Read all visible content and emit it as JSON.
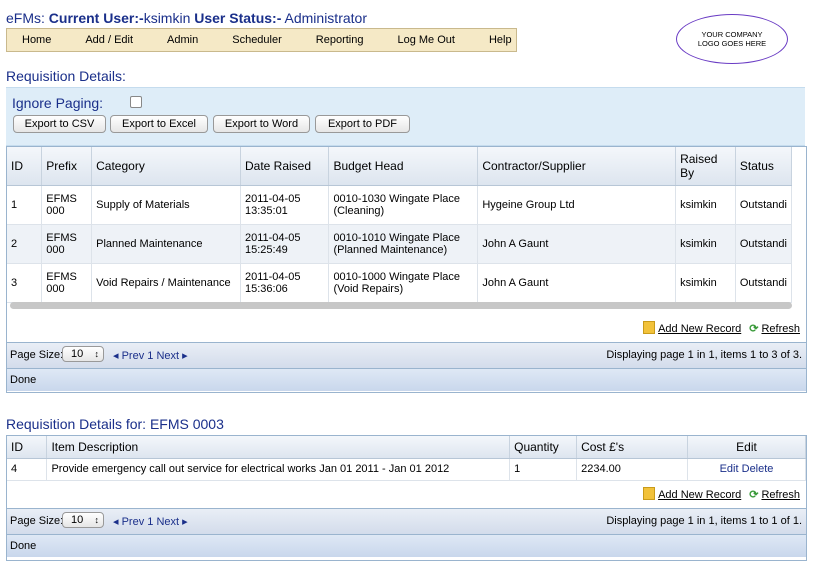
{
  "header": {
    "app": "eFMs:",
    "current_user_label": "Current User:-",
    "current_user": "ksimkin",
    "status_label": "User Status:-",
    "status": "Administrator"
  },
  "menu": [
    "Home",
    "Add / Edit",
    "Admin",
    "Scheduler",
    "Reporting",
    "Log Me Out",
    "Help"
  ],
  "logo_text": "YOUR COMPANY LOGO GOES HERE",
  "requisition": {
    "title": "Requisition Details:",
    "ignore_paging": "Ignore Paging:",
    "export_buttons": [
      "Export to CSV",
      "Export to Excel",
      "Export to Word",
      "Export to PDF"
    ],
    "columns": [
      "ID",
      "Prefix",
      "Category",
      "Date Raised",
      "Budget Head",
      "Contractor/Supplier",
      "Raised By",
      "Status"
    ],
    "rows": [
      {
        "id": "1",
        "prefix": "EFMS 000",
        "category": "Supply of Materials",
        "date": "2011-04-05 13:35:01",
        "budget": "0010-1030 Wingate Place (Cleaning)",
        "contractor": "Hygeine Group Ltd",
        "raised_by": "ksimkin",
        "status": "Outstandi"
      },
      {
        "id": "2",
        "prefix": "EFMS 000",
        "category": "Planned Maintenance",
        "date": "2011-04-05 15:25:49",
        "budget": "0010-1010 Wingate Place (Planned Maintenance)",
        "contractor": "John A Gaunt",
        "raised_by": "ksimkin",
        "status": "Outstandi"
      },
      {
        "id": "3",
        "prefix": "EFMS 000",
        "category": "Void Repairs / Maintenance",
        "date": "2011-04-05 15:36:06",
        "budget": "0010-1000 Wingate Place (Void Repairs)",
        "contractor": "John A Gaunt",
        "raised_by": "ksimkin",
        "status": "Outstandi"
      }
    ],
    "add_new": "Add New Record",
    "refresh": "Refresh",
    "page_size_label": "Page Size:",
    "page_size": "10",
    "prev": "Prev",
    "page": "1",
    "next": "Next",
    "displaying": "Displaying page 1 in 1, items 1 to 3 of 3.",
    "status": "Done"
  },
  "details": {
    "title": "Requisition Details for: EFMS 0003",
    "columns": [
      "ID",
      "Item Description",
      "Quantity",
      "Cost £'s",
      "Edit"
    ],
    "rows": [
      {
        "id": "4",
        "description": "Provide emergency call out service for electrical works Jan 01 2011 - Jan 01 2012",
        "quantity": "1",
        "cost": "2234.00",
        "edit": "Edit",
        "delete": "Delete"
      }
    ],
    "add_new": "Add New Record",
    "refresh": "Refresh",
    "page_size_label": "Page Size:",
    "page_size": "10",
    "prev": "Prev",
    "page": "1",
    "next": "Next",
    "displaying": "Displaying page 1 in 1, items 1 to 1 of 1.",
    "status": "Done"
  }
}
